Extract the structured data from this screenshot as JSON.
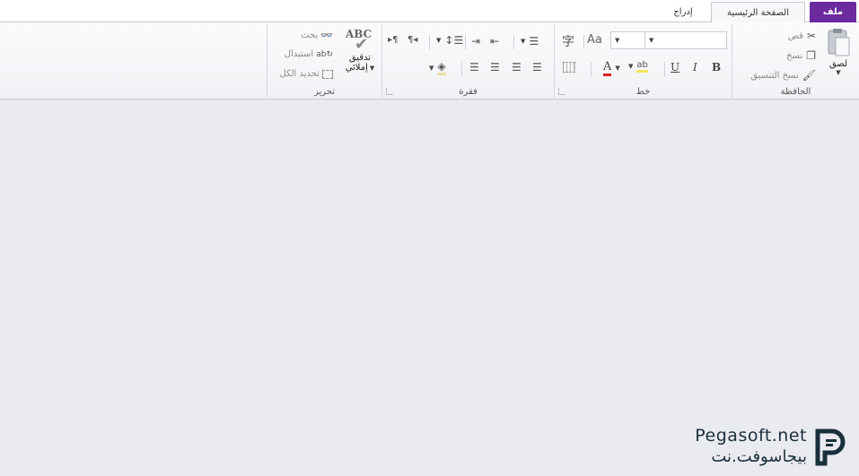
{
  "tabs": {
    "file": "ملف",
    "home": "الصفحة الرئيسية",
    "insert": "إدراج"
  },
  "clipboard": {
    "label": "الحافظة",
    "paste": "لصق",
    "cut": "قص",
    "copy": "نسخ",
    "format_painter": "نسخ التنسيق"
  },
  "font": {
    "label": "خط",
    "bold": "B",
    "italic": "I",
    "underline": "U",
    "font_color": "A",
    "highlight": "ab",
    "change_case": "Aa",
    "phonetic": "字"
  },
  "paragraph": {
    "label": "فقرة"
  },
  "editing": {
    "label": "تحرير",
    "spelling_line1": "تدقيق",
    "spelling_line2": "إملائي",
    "spelling_icon_text": "ABC",
    "find": "بحث",
    "replace": "استبدال",
    "select_all": "تحديد الكل"
  },
  "watermark": {
    "latin": "Pegasoft.net",
    "arabic": "بيجاسوفت.نت"
  },
  "colors": {
    "file_tab": "#6c2a9e",
    "workspace": "#eaebf0",
    "logo": "#1a2f3c"
  }
}
